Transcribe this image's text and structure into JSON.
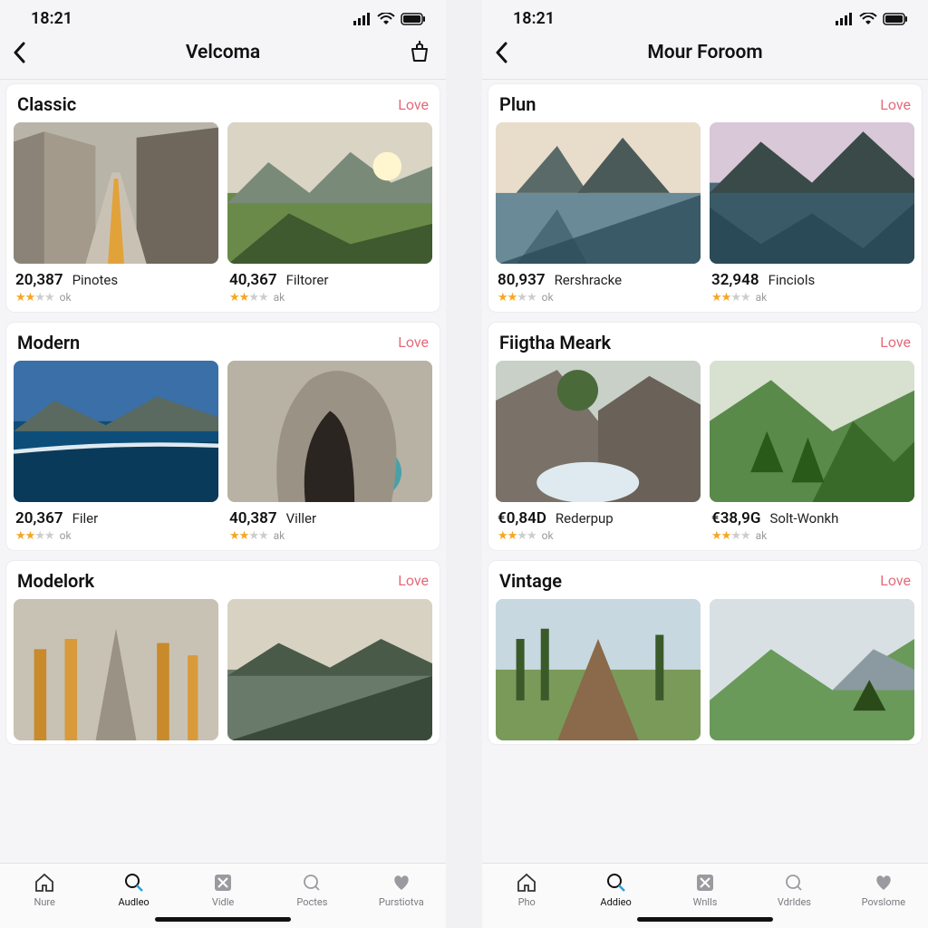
{
  "status": {
    "time": "18:21"
  },
  "phones": [
    {
      "title": "Velcoma",
      "nav_action_icon": "basket-icon",
      "sections": [
        {
          "title": "Classic",
          "link": "Love",
          "cards": [
            {
              "thumb": "street",
              "value": "20,387",
              "name": "Pinotes",
              "stars": 2,
              "ok": "ok"
            },
            {
              "thumb": "hill-sunset",
              "value": "40,367",
              "name": "Filtorer",
              "stars": 2,
              "ok": "ak"
            }
          ]
        },
        {
          "title": "Modern",
          "link": "Love",
          "cards": [
            {
              "thumb": "ocean",
              "value": "20,367",
              "name": "Filer",
              "stars": 2,
              "ok": "ok"
            },
            {
              "thumb": "cave",
              "value": "40,387",
              "name": "Viller",
              "stars": 2,
              "ok": "ak"
            }
          ]
        },
        {
          "title": "Modelork",
          "link": "Love",
          "cards": [
            {
              "thumb": "autumn-road",
              "value": "",
              "name": "",
              "stars": 0,
              "ok": ""
            },
            {
              "thumb": "lake-autumn",
              "value": "",
              "name": "",
              "stars": 0,
              "ok": ""
            }
          ]
        }
      ],
      "tabs": [
        {
          "icon": "home-icon",
          "label": "Nure",
          "active": false
        },
        {
          "icon": "search-icon",
          "label": "Audleo",
          "active": true
        },
        {
          "icon": "grid-icon",
          "label": "Vidle",
          "active": false
        },
        {
          "icon": "circle-search-icon",
          "label": "Poctes",
          "active": false
        },
        {
          "icon": "heart-icon",
          "label": "Purstiotva",
          "active": false
        }
      ]
    },
    {
      "title": "Mour Foroom",
      "nav_action_icon": "",
      "sections": [
        {
          "title": "Plun",
          "link": "Love",
          "cards": [
            {
              "thumb": "mountain-lake",
              "value": "80,937",
              "name": "Rershracke",
              "stars": 2,
              "ok": "ok"
            },
            {
              "thumb": "mountain-lake2",
              "value": "32,948",
              "name": "Finciols",
              "stars": 2,
              "ok": "ak"
            }
          ]
        },
        {
          "title": "Fiigtha Meark",
          "link": "Love",
          "cards": [
            {
              "thumb": "waterfall",
              "value": "€0,84D",
              "name": "Rederpup",
              "stars": 2,
              "ok": "ok"
            },
            {
              "thumb": "green-valley",
              "value": "€38,9G",
              "name": "Solt-Wonkh",
              "stars": 2,
              "ok": "ak"
            }
          ]
        },
        {
          "title": "Vintage",
          "link": "Love",
          "cards": [
            {
              "thumb": "boardwalk",
              "value": "",
              "name": "",
              "stars": 0,
              "ok": ""
            },
            {
              "thumb": "green-hill",
              "value": "",
              "name": "",
              "stars": 0,
              "ok": ""
            }
          ]
        }
      ],
      "tabs": [
        {
          "icon": "home-icon",
          "label": "Pho",
          "active": false
        },
        {
          "icon": "search-icon",
          "label": "Addieo",
          "active": true
        },
        {
          "icon": "grid-icon",
          "label": "Wnlls",
          "active": false
        },
        {
          "icon": "circle-search-icon",
          "label": "Vdrldes",
          "active": false
        },
        {
          "icon": "heart-icon",
          "label": "Povslome",
          "active": false
        }
      ]
    }
  ]
}
